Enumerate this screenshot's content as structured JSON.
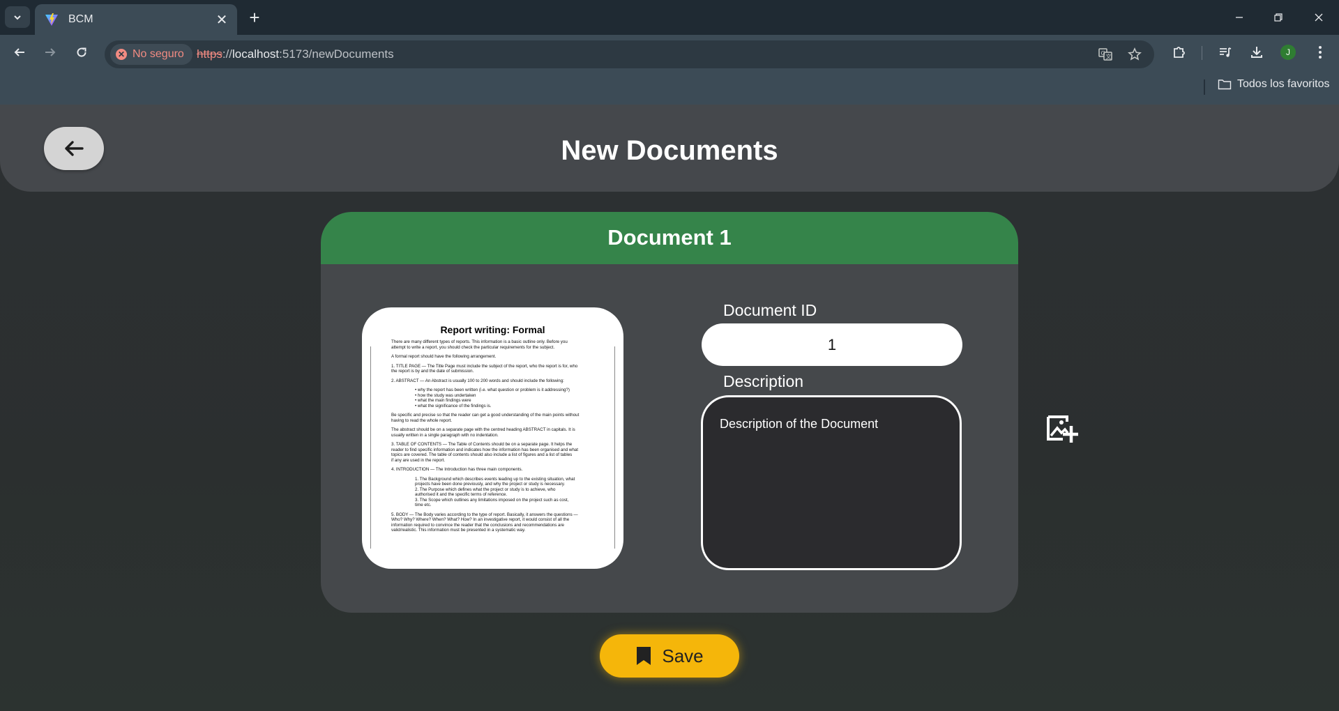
{
  "browser": {
    "tab_title": "BCM",
    "url_scheme": "https",
    "url_sep": "://",
    "url_host": "localhost",
    "url_rest": ":5173/newDocuments",
    "security_label": "No seguro",
    "profile_initial": "J",
    "bookmarks_folder": "Todos los favoritos"
  },
  "header": {
    "title": "New Documents"
  },
  "card": {
    "title": "Document 1",
    "id_label": "Document ID",
    "id_value": "1",
    "description_label": "Description",
    "description_value": "Description of the Document"
  },
  "document_preview": {
    "heading": "Report writing: Formal",
    "lines": [
      "There are many different types of reports. This information is a basic outline only. Before you",
      "attempt to write a report, you should check the particular requirements for the subject.",
      "",
      "A formal report should have the following arrangement.",
      "",
      "1.  TITLE PAGE — The Title Page must include the subject of the report, who the report is for, who",
      "the report is by and the date of submission.",
      "",
      "2.  ABSTRACT — An Abstract is usually 100 to 200 words and should include the following:",
      "",
      "•  why the report has been written (i.e. what question or problem is it addressing?)",
      "•  how the study was undertaken",
      "•  what the main findings were",
      "•  what the significance of the findings is.",
      "",
      "Be specific and precise so that the reader can get a good understanding of the main points without",
      "having to read the whole report.",
      "",
      "The abstract should be on a separate page with the centred heading ABSTRACT in capitals. It is",
      "usually written in a single paragraph with no indentation.",
      "",
      "3.  TABLE OF CONTENTS — The Table of Contents should be on a separate page. It helps the",
      "reader to find specific information and indicates how the information has been organised and what",
      "topics are covered. The table of contents should also include a list of figures and a list of tables",
      "if any are used in the report.",
      "",
      "4.  INTRODUCTION — The Introduction has three main components.",
      "",
      "1.  The Background which describes events leading up to the existing situation, what",
      "projects have been done previously, and why the project or study is necessary.",
      "2.  The Purpose which defines what the project or study is to achieve, who",
      "authorised it and the specific terms of reference.",
      "3.  The Scope which outlines any limitations imposed on the project such as cost,",
      "time etc.",
      "",
      "5.  BODY — The Body varies according to the type of report. Basically, it answers the questions —",
      "Who? Why? Where? When? What? How? In an investigative report, it would consist of all the",
      "information required to convince the reader that the conclusions and recommendations are",
      "valid/realistic. This information must be presented in a systematic way."
    ]
  },
  "actions": {
    "save_label": "Save"
  }
}
